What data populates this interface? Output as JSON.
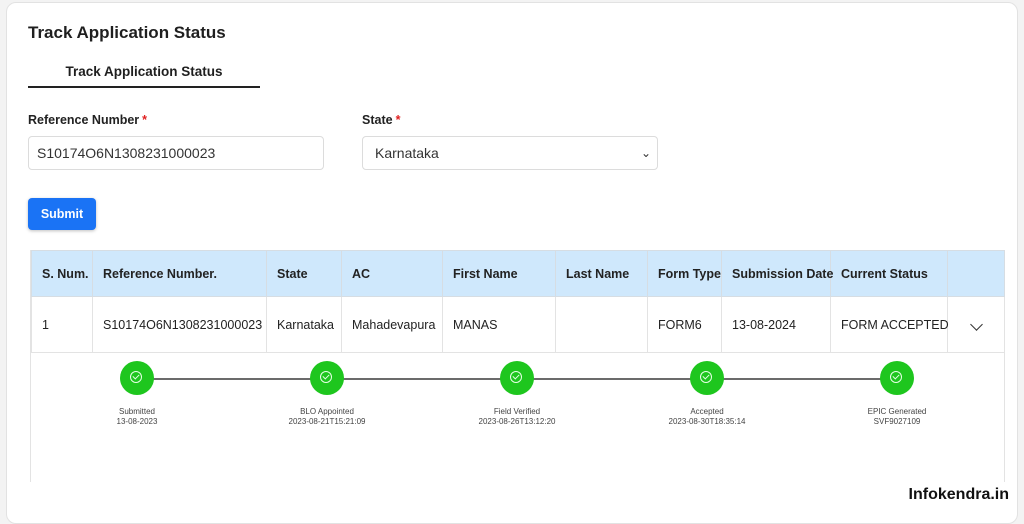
{
  "page": {
    "title": "Track Application Status",
    "tabs": [
      {
        "label": "Track Application Status",
        "active": true
      }
    ]
  },
  "form": {
    "reference_label": "Reference Number",
    "reference_value": "S10174O6N1308231000023",
    "state_label": "State",
    "state_value": "Karnataka",
    "required_marker": "*",
    "submit_label": "Submit"
  },
  "table": {
    "columns": [
      "S. Num.",
      "Reference Number.",
      "State",
      "AC",
      "First Name",
      "Last Name",
      "Form Type",
      "Submission Date",
      "Current Status",
      ""
    ],
    "rows": [
      {
        "s_num": "1",
        "reference_number": "S10174O6N1308231000023",
        "state": "Karnataka",
        "ac": "Mahadevapura",
        "first_name": "MANAS",
        "last_name": "",
        "form_type": "FORM6",
        "submission_date": "13-08-2024",
        "current_status": "FORM ACCEPTED",
        "expand_icon": "chevron-down-icon"
      }
    ]
  },
  "timeline": {
    "status_color": "#1ec61e",
    "steps": [
      {
        "title": "Submitted",
        "detail": "13-08-2023",
        "icon": "check-circle-icon"
      },
      {
        "title": "BLO Appointed",
        "detail": "2023-08-21T15:21:09",
        "icon": "check-circle-icon"
      },
      {
        "title": "Field Verified",
        "detail": "2023-08-26T13:12:20",
        "icon": "check-circle-icon"
      },
      {
        "title": "Accepted",
        "detail": "2023-08-30T18:35:14",
        "icon": "check-circle-icon"
      },
      {
        "title": "EPIC Generated",
        "detail": "SVF9027109",
        "icon": "check-circle-icon"
      }
    ]
  },
  "watermark": "Infokendra.in"
}
